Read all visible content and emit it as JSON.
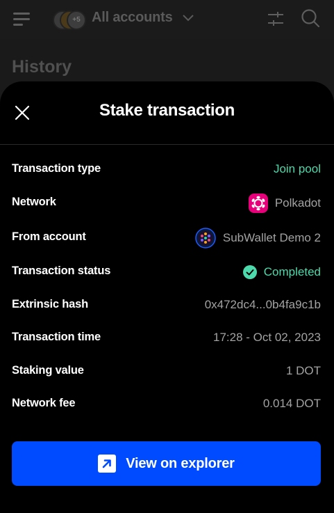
{
  "header": {
    "account_selector_label": "All accounts",
    "account_count_badge": "+5"
  },
  "background_page": {
    "title": "History"
  },
  "modal": {
    "title": "Stake transaction",
    "rows": [
      {
        "label": "Transaction type",
        "value": "Join pool"
      },
      {
        "label": "Network",
        "value": "Polkadot"
      },
      {
        "label": "From account",
        "value": "SubWallet Demo 2"
      },
      {
        "label": "Transaction status",
        "value": "Completed"
      },
      {
        "label": "Extrinsic hash",
        "value": "0x472dc4...0b4fa9c1b"
      },
      {
        "label": "Transaction time",
        "value": "17:28 - Oct 02, 2023"
      },
      {
        "label": "Staking value",
        "value": "1 DOT"
      },
      {
        "label": "Network fee",
        "value": "0.014 DOT"
      }
    ],
    "explorer_button_label": "View on explorer"
  },
  "colors": {
    "accent_blue": "#004bff",
    "success_green": "#4cd9ac",
    "polkadot_pink": "#e6007a",
    "sheet_background": "#000000"
  },
  "icons": [
    "menu-icon",
    "chevron-down-icon",
    "filter-icon",
    "search-icon",
    "close-icon",
    "polkadot-icon",
    "account-avatar-icon",
    "check-circle-icon",
    "external-link-icon"
  ]
}
